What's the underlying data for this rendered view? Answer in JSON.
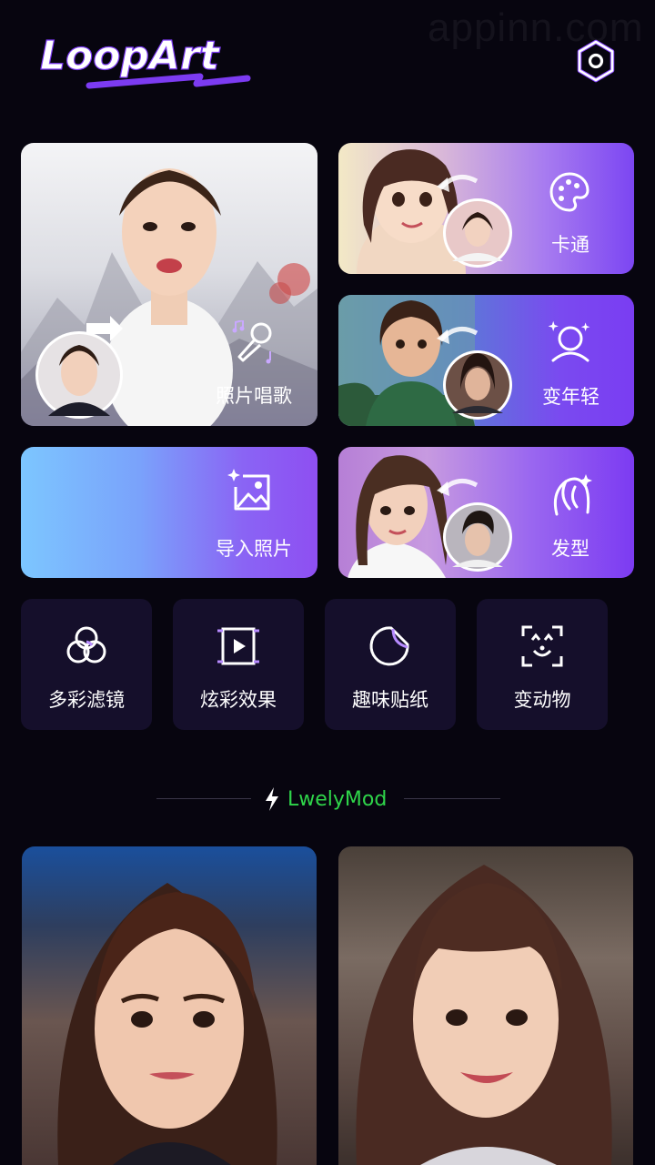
{
  "watermark": "appinn.com",
  "app": {
    "name": "LoopArt"
  },
  "header": {
    "settings_icon": "hexagon-settings-icon"
  },
  "features": {
    "sing": {
      "label": "照片唱歌",
      "icon": "microphone-music-icon"
    },
    "cartoon": {
      "label": "卡通",
      "icon": "palette-icon"
    },
    "young": {
      "label": "变年轻",
      "icon": "face-sparkle-icon"
    },
    "import": {
      "label": "导入照片",
      "icon": "image-sparkle-icon"
    },
    "hair": {
      "label": "发型",
      "icon": "hair-icon"
    }
  },
  "tools": [
    {
      "label": "多彩滤镜",
      "icon": "filter-circles-icon"
    },
    {
      "label": "炫彩效果",
      "icon": "video-effect-icon"
    },
    {
      "label": "趣味贴纸",
      "icon": "sticker-icon"
    },
    {
      "label": "变动物",
      "icon": "animal-scan-icon"
    }
  ],
  "brand": {
    "label": "LwelyMod",
    "icon": "lightning-icon",
    "color": "#2fd54a"
  },
  "colors": {
    "background": "#07050f",
    "accent": "#7c3bf2",
    "tile": "#150f2b"
  }
}
